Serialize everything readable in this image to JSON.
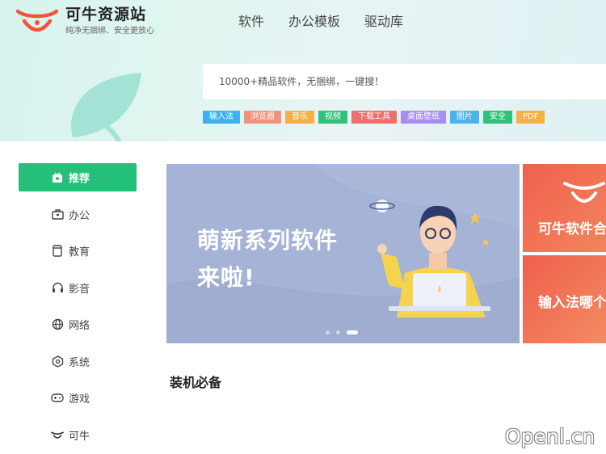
{
  "brand": {
    "name": "可牛资源站",
    "slogan": "纯净无捆绑、安全更放心",
    "logo_color": "#f0553b"
  },
  "nav": [
    "软件",
    "办公模板",
    "驱动库"
  ],
  "search": {
    "placeholder": "10000+精品软件，无捆绑，一键搜！"
  },
  "tags": [
    {
      "label": "输入法",
      "color": "#3fb1f0"
    },
    {
      "label": "浏览器",
      "color": "#f0937c"
    },
    {
      "label": "音乐",
      "color": "#f5b048"
    },
    {
      "label": "视频",
      "color": "#2ec27a"
    },
    {
      "label": "下载工具",
      "color": "#f06e6e"
    },
    {
      "label": "桌面壁纸",
      "color": "#a78ef0"
    },
    {
      "label": "图片",
      "color": "#4bb4f0"
    },
    {
      "label": "安全",
      "color": "#2ec27a"
    },
    {
      "label": "PDF",
      "color": "#f5b048"
    }
  ],
  "sidebar": {
    "items": [
      {
        "label": "推荐",
        "icon": "recommend-icon"
      },
      {
        "label": "办公",
        "icon": "briefcase-icon"
      },
      {
        "label": "教育",
        "icon": "book-icon"
      },
      {
        "label": "影音",
        "icon": "headphones-icon"
      },
      {
        "label": "网络",
        "icon": "globe-icon"
      },
      {
        "label": "系统",
        "icon": "gear-hex-icon"
      },
      {
        "label": "游戏",
        "icon": "gamepad-icon"
      },
      {
        "label": "可牛",
        "icon": "keniu-logo-icon"
      }
    ],
    "active_color": "#24c07a"
  },
  "banner": {
    "title_line1": "萌新系列软件",
    "title_line2": "来啦!",
    "slide_count": 3,
    "active_slide": 3
  },
  "promos": [
    {
      "text": "可牛软件合"
    },
    {
      "text": "输入法哪个"
    }
  ],
  "section": {
    "title": "装机必备"
  },
  "watermark": "Openl.cn"
}
